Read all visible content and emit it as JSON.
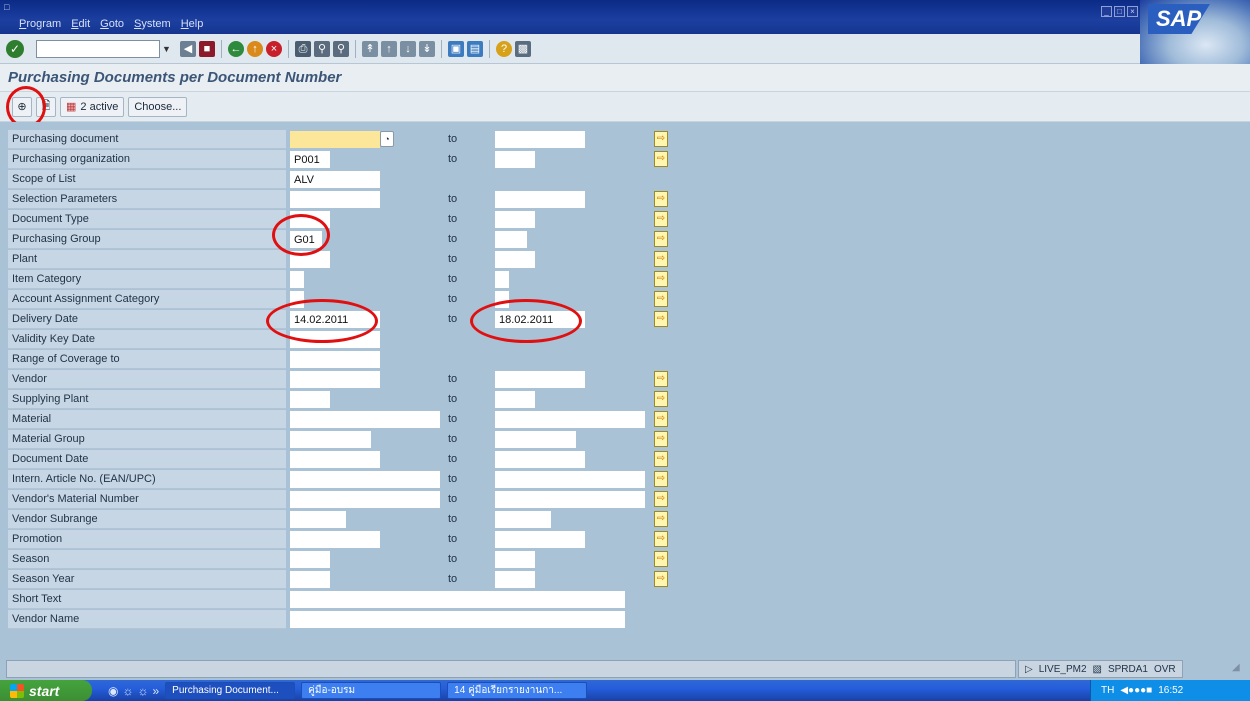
{
  "menubar": [
    "Program",
    "Edit",
    "Goto",
    "System",
    "Help"
  ],
  "std_toolbar": {
    "command_value": ""
  },
  "screen_title": "Purchasing Documents per Document Number",
  "app_toolbar": {
    "active_label": "2  active",
    "choose_label": "Choose..."
  },
  "rows": [
    {
      "label": "Purchasing document",
      "from": "",
      "from_w": 90,
      "to": true,
      "to_w": 90,
      "from_required": true,
      "help": true,
      "msel": true
    },
    {
      "label": "Purchasing organization",
      "from": "P001",
      "from_w": 40,
      "to": true,
      "to_w": 40,
      "msel": true
    },
    {
      "label": "Scope of List",
      "from": "ALV",
      "from_w": 90,
      "to": false,
      "msel": false
    },
    {
      "label": "Selection Parameters",
      "from": "",
      "from_w": 90,
      "to": true,
      "to_w": 90,
      "msel": true
    },
    {
      "label": "Document Type",
      "from": "",
      "from_w": 40,
      "to": true,
      "to_w": 40,
      "msel": true
    },
    {
      "label": "Purchasing Group",
      "from": "G01",
      "from_w": 32,
      "to": true,
      "to_w": 32,
      "msel": true
    },
    {
      "label": "Plant",
      "from": "",
      "from_w": 40,
      "to": true,
      "to_w": 40,
      "msel": true
    },
    {
      "label": "Item Category",
      "from": "",
      "from_w": 14,
      "to": true,
      "to_w": 14,
      "msel": true
    },
    {
      "label": "Account Assignment Category",
      "from": "",
      "from_w": 14,
      "to": true,
      "to_w": 14,
      "msel": true
    },
    {
      "label": "Delivery Date",
      "from": "14.02.2011",
      "from_w": 90,
      "to": true,
      "to_w": 90,
      "to_value": "18.02.2011",
      "msel": true
    },
    {
      "label": "Validity Key Date",
      "from": "",
      "from_w": 90,
      "to": false,
      "msel": false
    },
    {
      "label": "Range of Coverage to",
      "from": "",
      "from_w": 90,
      "to": false,
      "msel": false
    },
    {
      "label": "Vendor",
      "from": "",
      "from_w": 90,
      "to": true,
      "to_w": 90,
      "msel": true
    },
    {
      "label": "Supplying Plant",
      "from": "",
      "from_w": 40,
      "to": true,
      "to_w": 40,
      "msel": true
    },
    {
      "label": "Material",
      "from": "",
      "from_w": 150,
      "to": true,
      "to_w": 150,
      "msel": true
    },
    {
      "label": "Material Group",
      "from": "",
      "from_w": 81,
      "to": true,
      "to_w": 81,
      "msel": true
    },
    {
      "label": "Document Date",
      "from": "",
      "from_w": 90,
      "to": true,
      "to_w": 90,
      "msel": true
    },
    {
      "label": "Intern. Article No. (EAN/UPC)",
      "from": "",
      "from_w": 150,
      "to": true,
      "to_w": 150,
      "msel": true
    },
    {
      "label": "Vendor's Material Number",
      "from": "",
      "from_w": 150,
      "to": true,
      "to_w": 150,
      "msel": true
    },
    {
      "label": "Vendor Subrange",
      "from": "",
      "from_w": 56,
      "to": true,
      "to_w": 56,
      "msel": true
    },
    {
      "label": "Promotion",
      "from": "",
      "from_w": 90,
      "to": true,
      "to_w": 90,
      "msel": true
    },
    {
      "label": "Season",
      "from": "",
      "from_w": 40,
      "to": true,
      "to_w": 40,
      "msel": true
    },
    {
      "label": "Season Year",
      "from": "",
      "from_w": 40,
      "to": true,
      "to_w": 40,
      "msel": true
    },
    {
      "label": "Short Text",
      "from": "",
      "from_w": 335,
      "to": false,
      "msel": false
    },
    {
      "label": "Vendor Name",
      "from": "",
      "from_w": 335,
      "to": false,
      "msel": false
    }
  ],
  "to_label": "to",
  "statusbar": {
    "system": "LIVE_PM2",
    "client": "SPRDA1",
    "mode": "OVR"
  },
  "taskbar": {
    "start": "start",
    "tasks": [
      "Purchasing Document...",
      "คู่มือ-อบรม",
      "14 คู่มือเรียกรายงานกา..."
    ],
    "tray_lang": "TH",
    "clock": "16:52"
  },
  "sap_logo_text": "SAP",
  "colors": {
    "title_bar": "#1c3fa0",
    "screen_bg": "#a9c2d6",
    "required_field": "#fbe69a",
    "highlight_ring": "#e01010"
  }
}
